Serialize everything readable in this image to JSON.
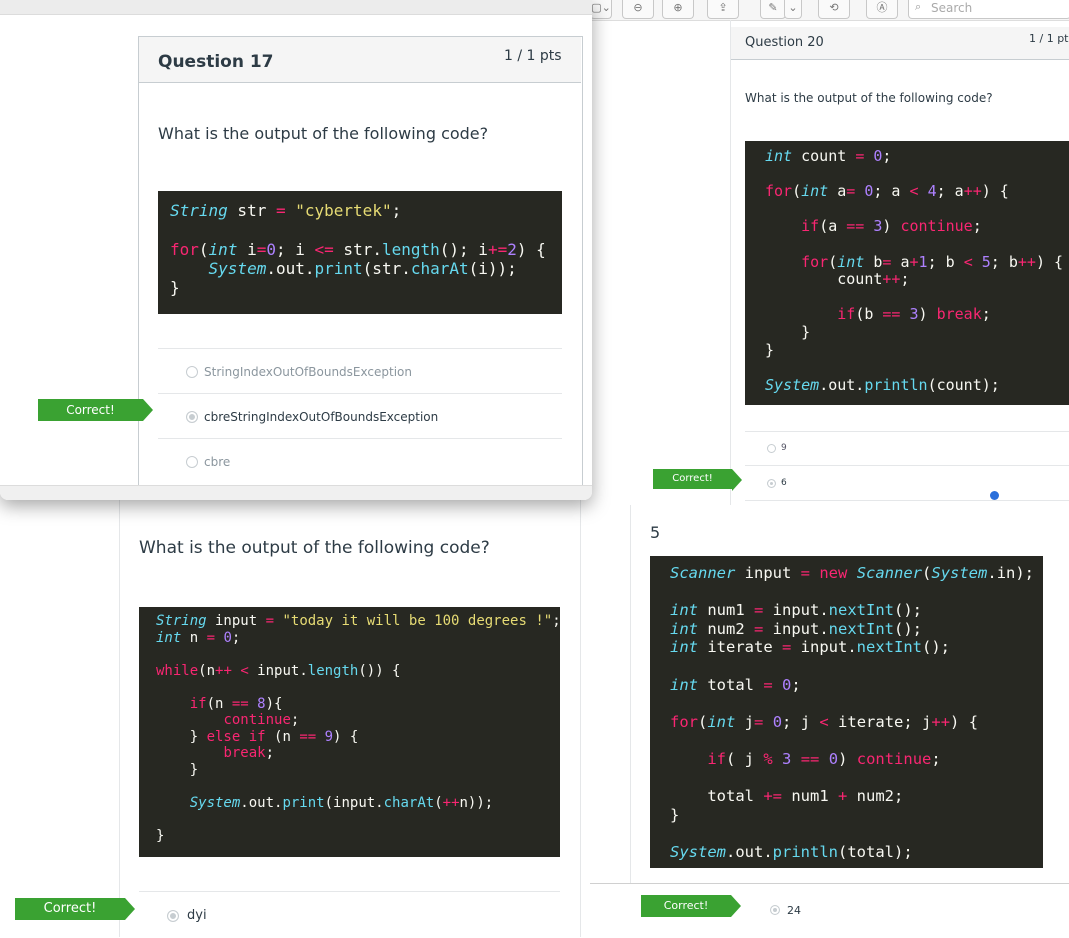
{
  "toolbar": {
    "search_placeholder": "Search",
    "icons": [
      "zoom-out-icon",
      "zoom-in-icon",
      "share-icon",
      "pen-icon",
      "chevron-down-icon",
      "rotate-icon",
      "markup-icon",
      "search-icon"
    ]
  },
  "q17": {
    "title": "Question 17",
    "pts": "1 / 1 pts",
    "prompt": "What is the output of the following code?",
    "answers": [
      "StringIndexOutOfBoundsException",
      "cbreStringIndexOutOfBoundsException",
      "cbre"
    ],
    "correct_label": "Correct!"
  },
  "q20": {
    "title": "Question 20",
    "pts": "1 / 1 pt",
    "prompt": "What is the output of the following code?",
    "answers": [
      "9",
      "6"
    ],
    "correct_label": "Correct!"
  },
  "q_bottom_left": {
    "prompt": "What is the output of the following code?",
    "answer": "dyi",
    "correct_label": "Correct!"
  },
  "q_bottom_right": {
    "number_label": "5",
    "answer": "24",
    "correct_label": "Correct!"
  },
  "colors": {
    "correct": "#3aa232",
    "code_bg": "#272822"
  }
}
